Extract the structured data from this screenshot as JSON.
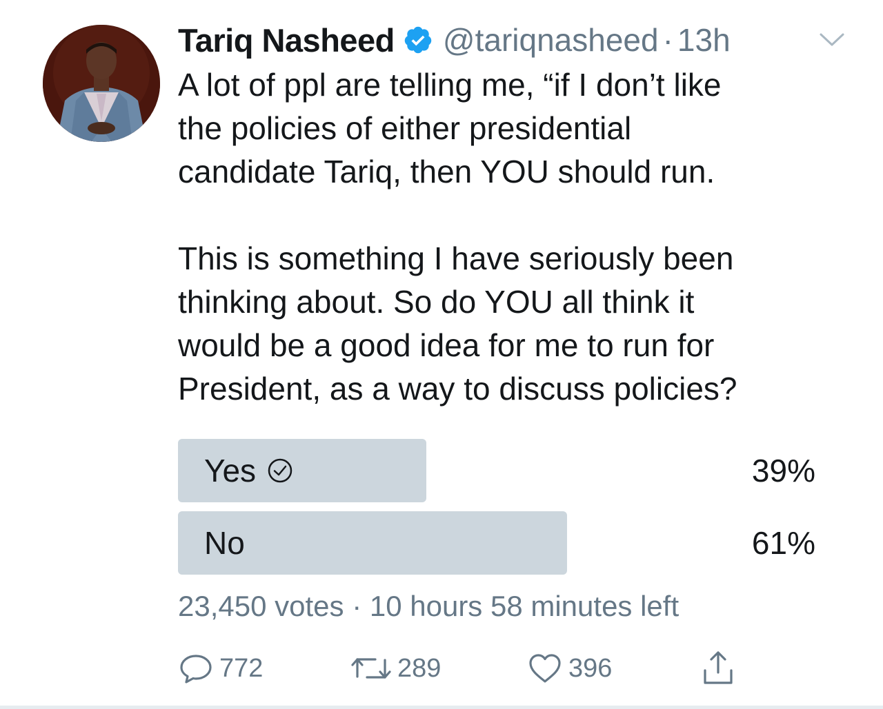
{
  "tweet": {
    "author_name": "Tariq Nasheed",
    "handle": "@tariqnasheed",
    "separator": "·",
    "time": "13h",
    "text": "A lot of ppl are telling me, “if I don’t like\nthe policies of either presidential\ncandidate Tariq, then YOU should run.\n\nThis is something I have seriously been\nthinking about. So do YOU all think it\nwould be a good idea for me to run for\nPresident, as a way to discuss policies?"
  },
  "poll": {
    "options": [
      {
        "label": "Yes",
        "percent_text": "39%",
        "fraction": 0.39,
        "selected": true
      },
      {
        "label": "No",
        "percent_text": "61%",
        "fraction": 0.61,
        "selected": false
      }
    ],
    "votes": "23,450 votes",
    "separator": "·",
    "time_left": "10 hours 58 minutes left"
  },
  "actions": {
    "reply_count": "772",
    "retweet_count": "289",
    "like_count": "396"
  },
  "icons": {
    "verified": "verified-badge-icon",
    "caret": "chevron-down-icon",
    "check": "check-circle-icon",
    "reply": "reply-icon",
    "retweet": "retweet-icon",
    "like": "heart-icon",
    "share": "share-icon"
  },
  "colors": {
    "verified_blue": "#1da1f2",
    "secondary_text": "#657786",
    "poll_bar": "#ccd6dd",
    "primary_text": "#14171a"
  }
}
